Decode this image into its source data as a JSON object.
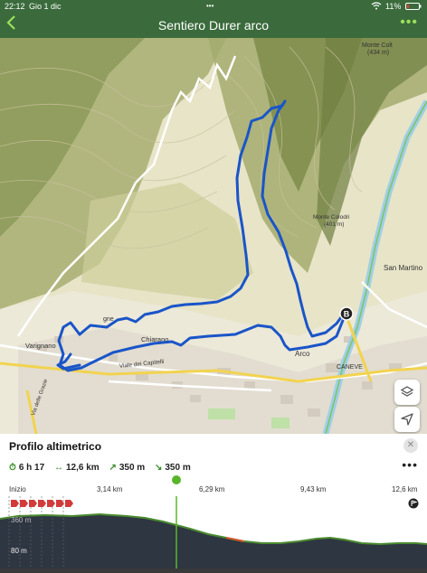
{
  "status_bar": {
    "time": "22:12",
    "date": "Gio 1 dic",
    "battery": "11%"
  },
  "header": {
    "back_icon": "chevron-left-icon",
    "title": "Sentiero Durer arco",
    "more_icon": "more-dots-icon"
  },
  "map": {
    "labels": {
      "monte_colt": "Monte Colt",
      "monte_colt_elev": "(434 m)",
      "monte_colodri": "Monte Colodri",
      "colodri_elev": "(401 m)",
      "san_martino": "San Martino",
      "vignole": "gne",
      "varignano": "Varignano",
      "chiarano": "Chiarano",
      "viale": "Viale dei Capitelli",
      "arco": "Arco",
      "caneve": "CANEVE",
      "grazie": "Via delle Grazie"
    },
    "end_marker": "B",
    "route_color": "#1a55c8",
    "controls": [
      {
        "icon": "layers-icon"
      },
      {
        "icon": "navigate-arrow-icon"
      }
    ]
  },
  "profile": {
    "title": "Profilo altimetrico",
    "close_icon": "close-icon",
    "stats": {
      "duration": "6 h 17",
      "distance": "12,6 km",
      "ascent": "350 m",
      "descent": "350 m"
    },
    "more_icon": "more-dots-icon",
    "axis": [
      "Inizio",
      "3,14 km",
      "6,29 km",
      "9,43 km",
      "12,6 km"
    ],
    "y_labels": {
      "top": "360 m",
      "bottom": "80 m"
    },
    "cursor_color": "#5ab52a"
  }
}
